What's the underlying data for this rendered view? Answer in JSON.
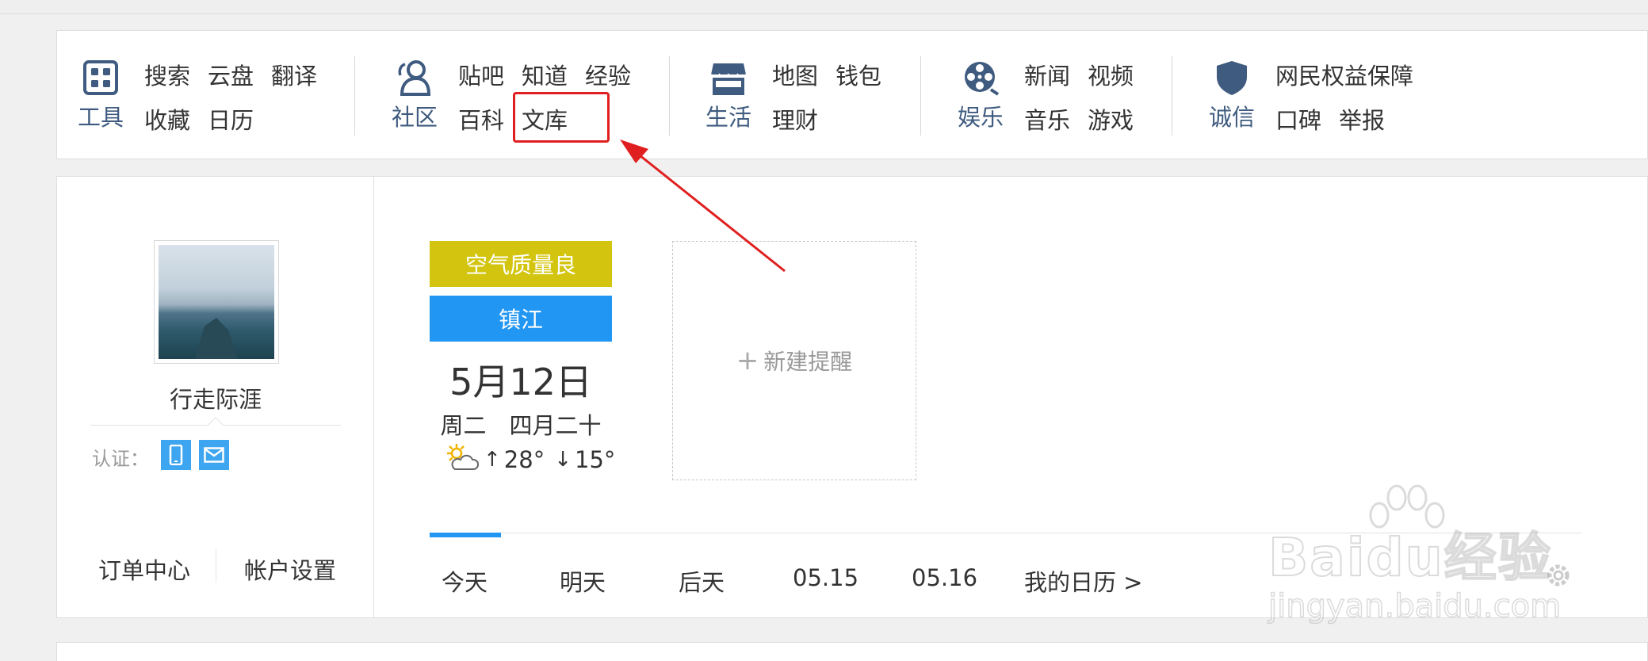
{
  "nav": {
    "tools": {
      "label": "工具",
      "icon": "apps-grid-icon",
      "row1": [
        "搜索",
        "云盘",
        "翻译"
      ],
      "row2": [
        "收藏",
        "日历"
      ]
    },
    "community": {
      "label": "社区",
      "icon": "people-icon",
      "row1": [
        "贴吧",
        "知道",
        "经验"
      ],
      "row2": [
        "百科",
        "文库"
      ]
    },
    "life": {
      "label": "生活",
      "icon": "store-icon",
      "row1": [
        "地图",
        "钱包"
      ],
      "row2": [
        "理财"
      ]
    },
    "entertainment": {
      "label": "娱乐",
      "icon": "film-reel-icon",
      "row1": [
        "新闻",
        "视频"
      ],
      "row2": [
        "音乐",
        "游戏"
      ]
    },
    "integrity": {
      "label": "诚信",
      "icon": "shield-icon",
      "row1": [
        "网民权益保障"
      ],
      "row2": [
        "口碑",
        "举报"
      ]
    }
  },
  "profile": {
    "username": "行走际涯",
    "cert_label": "认证：",
    "order_center": "订单中心",
    "account_settings": "帐户设置"
  },
  "calendar": {
    "air_quality": "空气质量良",
    "city": "镇江",
    "date": "5月12日",
    "weekday": "周二",
    "lunar": "四月二十",
    "high": "28°",
    "low": "15°",
    "weather_icon": "partly-sunny-icon"
  },
  "reminder": {
    "plus": "+",
    "label": "新建提醒"
  },
  "tabs": [
    "今天",
    "明天",
    "后天",
    "05.15",
    "05.16",
    "我的日历 >"
  ],
  "active_tab": 0,
  "watermark": {
    "main": "Baidu经验",
    "url": "jingyan.baidu.com"
  },
  "colors": {
    "air_badge": "#d3c50f",
    "city_badge": "#2196f3",
    "highlight": "#e02020",
    "nav_label": "#3f5b7f"
  }
}
